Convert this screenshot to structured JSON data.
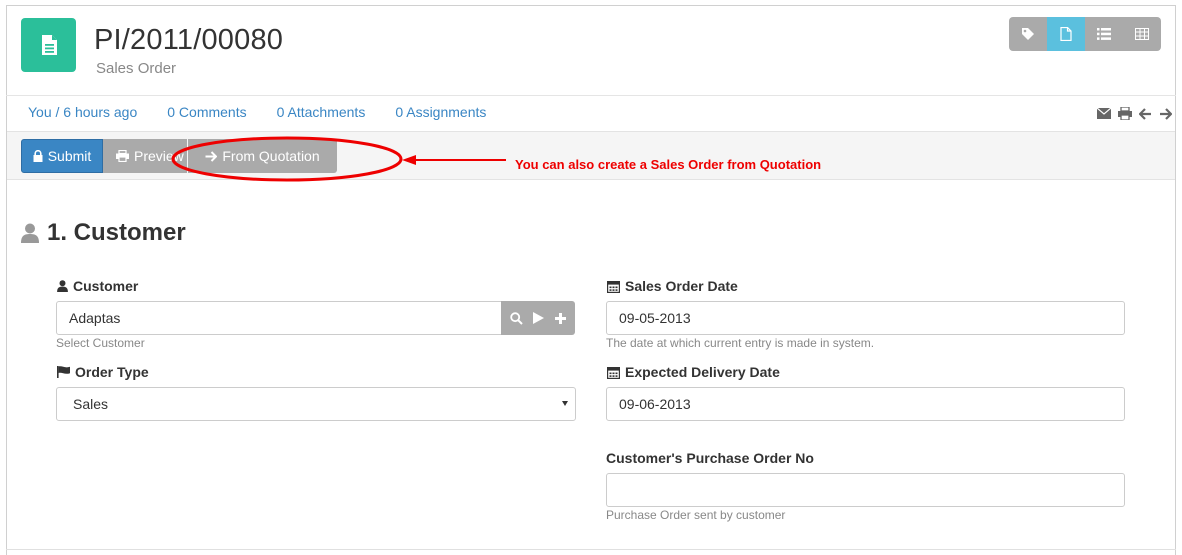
{
  "header": {
    "title": "PI/2011/00080",
    "subtitle": "Sales Order",
    "view_buttons": [
      {
        "icon": "tag-icon"
      },
      {
        "icon": "file-icon",
        "active": true
      },
      {
        "icon": "list-icon"
      },
      {
        "icon": "grid-icon"
      }
    ]
  },
  "infobar": {
    "owner": "You / 6 hours ago",
    "comments": "0 Comments",
    "attachments": "0 Attachments",
    "assignments": "0 Assignments"
  },
  "toolbar": {
    "submit_label": "Submit",
    "preview_label": "Preview",
    "from_quotation_label": "From Quotation"
  },
  "annotation": {
    "text": "You can also create a Sales Order from Quotation",
    "color": "#e00000"
  },
  "section": {
    "title": "1. Customer"
  },
  "form": {
    "customer": {
      "label": "Customer",
      "value": "Adaptas",
      "help": "Select Customer"
    },
    "order_type": {
      "label": "Order Type",
      "value": "Sales"
    },
    "sales_order_date": {
      "label": "Sales Order Date",
      "value": "09-05-2013",
      "help": "The date at which current entry is made in system."
    },
    "expected_delivery_date": {
      "label": "Expected Delivery Date",
      "value": "09-06-2013"
    },
    "purchase_order_no": {
      "label": "Customer's Purchase Order No",
      "value": "",
      "help": "Purchase Order sent by customer"
    }
  },
  "colors": {
    "primary": "#3a86c4",
    "accent": "#2bbf9a",
    "active_view": "#5bc0de",
    "button_gray": "#aaaaaa"
  }
}
